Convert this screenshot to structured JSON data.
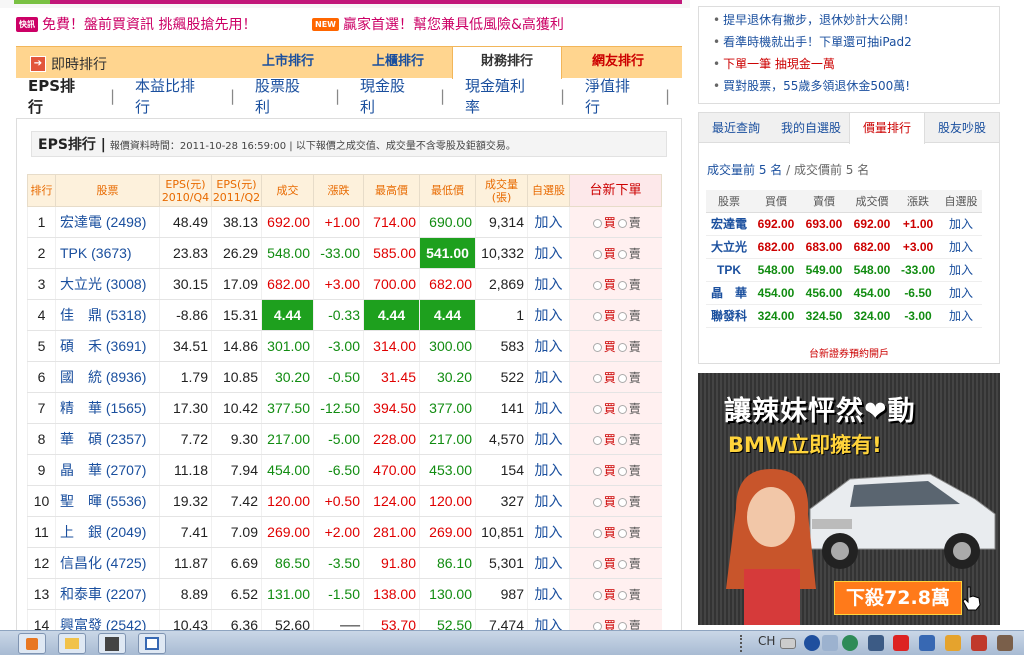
{
  "promos": [
    {
      "badge": "快訊",
      "text": "免費！盤前買資訊 挑飆股搶先用！",
      "badge_color": "#cc0066"
    },
    {
      "badge": "NEW",
      "text": "贏家首選！幫您兼具低風險&高獲利",
      "badge_color": "#ff6600"
    }
  ],
  "nav": {
    "home": "即時排行",
    "tabs": [
      "上市排行",
      "上櫃排行",
      "財務排行",
      "網友排行"
    ],
    "active": "財務排行"
  },
  "subnav": [
    "EPS排行",
    "本益比排行",
    "股票股利",
    "現金股利",
    "現金殖利率",
    "淨值排行"
  ],
  "info": {
    "title": "EPS排行 |",
    "desc": "報價資料時間：2011-10-28 16:59:00 | 以下報價之成交值、成交量不含零股及鉅額交易。"
  },
  "table": {
    "headers": [
      "排行",
      "股票",
      "EPS(元)\n2010/Q4",
      "EPS(元)\n2011/Q2",
      "成交",
      "漲跌",
      "最高價",
      "最低價",
      "成交量\n(張)",
      "自選股",
      "台新下單"
    ],
    "add_label": "加入",
    "buy_label": "買",
    "sell_label": "賣",
    "rows": [
      {
        "rank": "1",
        "name": "宏達電",
        "code": "(2498)",
        "eps1": "48.49",
        "eps2": "38.13",
        "price": "692.00",
        "chg": "+1.00",
        "high": "714.00",
        "low": "690.00",
        "vol": "9,314",
        "pc": "up",
        "cc": "up",
        "hc": "up",
        "lc": "dn",
        "hl": []
      },
      {
        "rank": "2",
        "name": "TPK",
        "code": "(3673)",
        "eps1": "23.83",
        "eps2": "26.29",
        "price": "548.00",
        "chg": "-33.00",
        "high": "585.00",
        "low": "541.00",
        "vol": "10,332",
        "pc": "dn",
        "cc": "dn",
        "hc": "up",
        "lc": "dn",
        "hl": [
          "low"
        ]
      },
      {
        "rank": "3",
        "name": "大立光",
        "code": "(3008)",
        "eps1": "30.15",
        "eps2": "17.09",
        "price": "682.00",
        "chg": "+3.00",
        "high": "700.00",
        "low": "682.00",
        "vol": "2,869",
        "pc": "up",
        "cc": "up",
        "hc": "up",
        "lc": "up",
        "hl": []
      },
      {
        "rank": "4",
        "name": "佳　鼎",
        "code": "(5318)",
        "eps1": "-8.86",
        "eps2": "15.31",
        "price": "4.44",
        "chg": "-0.33",
        "high": "4.44",
        "low": "4.44",
        "vol": "1",
        "pc": "dn",
        "cc": "dn",
        "hc": "dn",
        "lc": "dn",
        "hl": [
          "price",
          "high",
          "low"
        ]
      },
      {
        "rank": "5",
        "name": "碩　禾",
        "code": "(3691)",
        "eps1": "34.51",
        "eps2": "14.86",
        "price": "301.00",
        "chg": "-3.00",
        "high": "314.00",
        "low": "300.00",
        "vol": "583",
        "pc": "dn",
        "cc": "dn",
        "hc": "up",
        "lc": "dn",
        "hl": []
      },
      {
        "rank": "6",
        "name": "國　統",
        "code": "(8936)",
        "eps1": "1.79",
        "eps2": "10.85",
        "price": "30.20",
        "chg": "-0.50",
        "high": "31.45",
        "low": "30.20",
        "vol": "522",
        "pc": "dn",
        "cc": "dn",
        "hc": "up",
        "lc": "dn",
        "hl": []
      },
      {
        "rank": "7",
        "name": "精　華",
        "code": "(1565)",
        "eps1": "17.30",
        "eps2": "10.42",
        "price": "377.50",
        "chg": "-12.50",
        "high": "394.50",
        "low": "377.00",
        "vol": "141",
        "pc": "dn",
        "cc": "dn",
        "hc": "up",
        "lc": "dn",
        "hl": []
      },
      {
        "rank": "8",
        "name": "華　碩",
        "code": "(2357)",
        "eps1": "7.72",
        "eps2": "9.30",
        "price": "217.00",
        "chg": "-5.00",
        "high": "228.00",
        "low": "217.00",
        "vol": "4,570",
        "pc": "dn",
        "cc": "dn",
        "hc": "up",
        "lc": "dn",
        "hl": []
      },
      {
        "rank": "9",
        "name": "晶　華",
        "code": "(2707)",
        "eps1": "11.18",
        "eps2": "7.94",
        "price": "454.00",
        "chg": "-6.50",
        "high": "470.00",
        "low": "453.00",
        "vol": "154",
        "pc": "dn",
        "cc": "dn",
        "hc": "up",
        "lc": "dn",
        "hl": []
      },
      {
        "rank": "10",
        "name": "聖　暉",
        "code": "(5536)",
        "eps1": "19.32",
        "eps2": "7.42",
        "price": "120.00",
        "chg": "+0.50",
        "high": "124.00",
        "low": "120.00",
        "vol": "327",
        "pc": "up",
        "cc": "up",
        "hc": "up",
        "lc": "up",
        "hl": []
      },
      {
        "rank": "11",
        "name": "上　銀",
        "code": "(2049)",
        "eps1": "7.41",
        "eps2": "7.09",
        "price": "269.00",
        "chg": "+2.00",
        "high": "281.00",
        "low": "269.00",
        "vol": "10,851",
        "pc": "up",
        "cc": "up",
        "hc": "up",
        "lc": "up",
        "hl": []
      },
      {
        "rank": "12",
        "name": "信昌化",
        "code": "(4725)",
        "eps1": "11.87",
        "eps2": "6.69",
        "price": "86.50",
        "chg": "-3.50",
        "high": "91.80",
        "low": "86.10",
        "vol": "5,301",
        "pc": "dn",
        "cc": "dn",
        "hc": "up",
        "lc": "dn",
        "hl": []
      },
      {
        "rank": "13",
        "name": "和泰車",
        "code": "(2207)",
        "eps1": "8.89",
        "eps2": "6.52",
        "price": "131.00",
        "chg": "-1.50",
        "high": "138.00",
        "low": "130.00",
        "vol": "987",
        "pc": "dn",
        "cc": "dn",
        "hc": "up",
        "lc": "dn",
        "hl": []
      },
      {
        "rank": "14",
        "name": "興富發",
        "code": "(2542)",
        "eps1": "10.43",
        "eps2": "6.36",
        "price": "52.60",
        "chg": "──",
        "high": "53.70",
        "low": "52.50",
        "vol": "7,474",
        "pc": "",
        "cc": "",
        "hc": "up",
        "lc": "dn",
        "hl": []
      }
    ]
  },
  "sidebar": {
    "links": [
      {
        "text": "提早退休有撇步，退休妙計大公開！",
        "color": "#1a4f9e"
      },
      {
        "text": "看準時機就出手！下單還可抽iPad2",
        "color": "#1a4f9e"
      },
      {
        "text": "下單一筆 抽現金一萬",
        "color": "#cc0000"
      },
      {
        "text": "買對股票，55歲多領退休金500萬!",
        "color": "#1a4f9e"
      }
    ],
    "quote_tabs": [
      "最近查詢",
      "我的自選股",
      "價量排行",
      "股友吵股"
    ],
    "quote_active": "價量排行",
    "quote_sel_on": "成交量前 5 名",
    "quote_sel_sep": " / ",
    "quote_sel_off": "成交價前 5 名",
    "quote_headers": [
      "股票",
      "買價",
      "賣價",
      "成交價",
      "漲跌",
      "自選股"
    ],
    "quote_rows": [
      {
        "name": "宏達電",
        "bid": "692.00",
        "ask": "693.00",
        "price": "692.00",
        "chg": "+1.00",
        "up": true
      },
      {
        "name": "大立光",
        "bid": "682.00",
        "ask": "683.00",
        "price": "682.00",
        "chg": "+3.00",
        "up": true
      },
      {
        "name": "TPK",
        "bid": "548.00",
        "ask": "549.00",
        "price": "548.00",
        "chg": "-33.00",
        "up": false
      },
      {
        "name": "晶　華",
        "bid": "454.00",
        "ask": "456.00",
        "price": "454.00",
        "chg": "-6.50",
        "up": false
      },
      {
        "name": "聯發科",
        "bid": "324.00",
        "ask": "324.50",
        "price": "324.00",
        "chg": "-3.00",
        "up": false
      }
    ],
    "quote_add": "加入",
    "open_account": "台新證券預約開戶",
    "ad": {
      "headline": "讓辣妹怦然❤動",
      "sub": "BMW立即擁有!",
      "cta": "下殺72.8萬"
    }
  },
  "taskbar": {
    "ime": "CH"
  }
}
